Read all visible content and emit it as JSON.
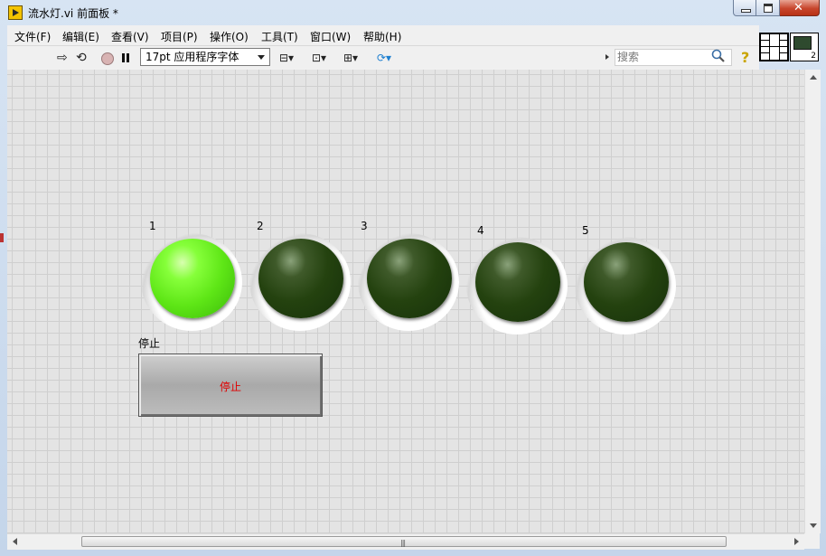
{
  "window": {
    "title": "流水灯.vi 前面板 *"
  },
  "menu": [
    "文件(F)",
    "编辑(E)",
    "查看(V)",
    "项目(P)",
    "操作(O)",
    "工具(T)",
    "窗口(W)",
    "帮助(H)"
  ],
  "toolbar": {
    "font_select": "17pt 应用程序字体",
    "search_placeholder": "搜索",
    "icons": [
      "run-arrow-icon",
      "run-continuously-icon",
      "abort-icon",
      "pause-icon",
      "align-icon",
      "distribute-icon",
      "resize-icon",
      "reorder-icon",
      "search-icon",
      "help-icon"
    ]
  },
  "vi_icon_number": "2",
  "leds": [
    {
      "label": "1",
      "state": "on"
    },
    {
      "label": "2",
      "state": "off"
    },
    {
      "label": "3",
      "state": "off"
    },
    {
      "label": "4",
      "state": "off"
    },
    {
      "label": "5",
      "state": "off"
    }
  ],
  "stop": {
    "label": "停止",
    "button_text": "停止",
    "text_color": "#e00000"
  },
  "colors": {
    "led_on": "#5ee616",
    "led_off": "#24420f",
    "panel_bg": "#e4e4e4"
  }
}
